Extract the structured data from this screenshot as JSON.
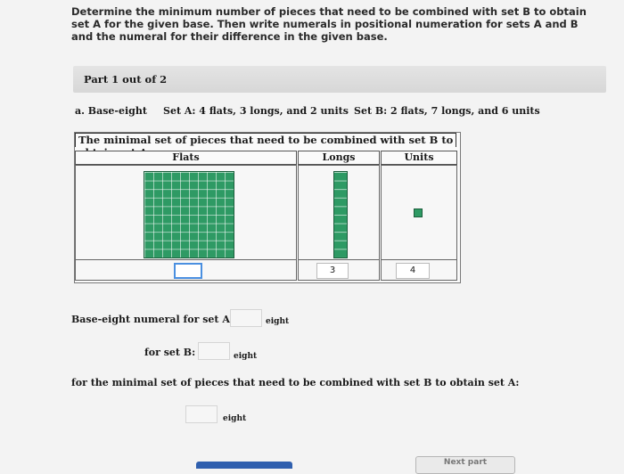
{
  "instructions": "Determine the minimum number of pieces that need to be combined with set B to obtain set A for the given base. Then write numerals in positional numeration for sets A and B and the numeral for their difference in the given base.",
  "part": {
    "label": "Part 1 out of 2"
  },
  "problem": {
    "label": "a. Base-eight",
    "set_a": "Set A: 4 flats, 3 longs, and 2 units",
    "set_b": "Set B: 2 flats, 7 longs, and 6 units"
  },
  "table": {
    "caption": "The minimal set of pieces that need to be combined with set B to obtain set A",
    "headers": [
      "Flats",
      "Longs",
      "Units"
    ],
    "inputs": {
      "flats": "",
      "longs": "3",
      "units": "4"
    }
  },
  "answers": {
    "set_a_label": "Base-eight numeral for set A:",
    "set_b_label": "for set B:",
    "difference_label": "for the minimal set of pieces that need to be combined with set B to obtain set A:",
    "base_word": "eight"
  },
  "buttons": {
    "next": "Next part"
  },
  "colors": {
    "block_green": "#2e9a64",
    "focus_blue": "#4a8fe0",
    "nav_blue": "#2f5fae"
  }
}
